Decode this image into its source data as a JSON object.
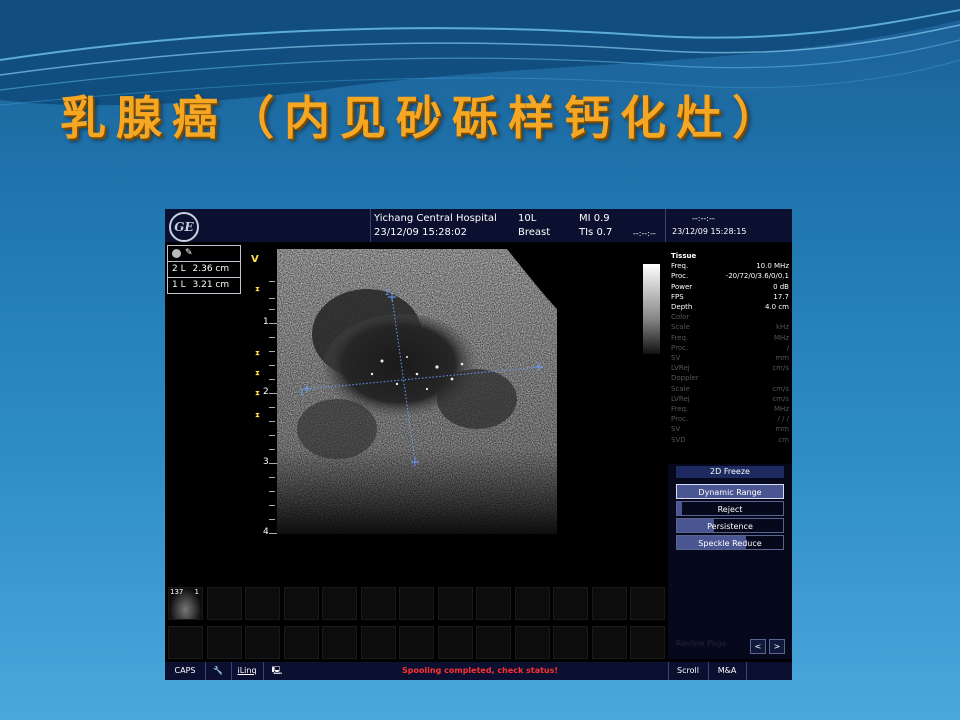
{
  "slide": {
    "title": "乳腺癌（内见砂砾样钙化灶）"
  },
  "device": {
    "logo": "GE",
    "hospital": "Yichang Central Hospital",
    "exam_datetime": "23/12/09 15:28:02",
    "probe": "10L",
    "preset": "Breast",
    "mi": "MI 0.9",
    "tis": "TIs 0.7",
    "time_placeholder": "--:--:--",
    "clock_top": "--:--:--",
    "clock_datetime": "23/12/09 15:28:15",
    "v_marker": "V"
  },
  "measurements": [
    {
      "index": "2",
      "type": "L",
      "value": "2.36 cm"
    },
    {
      "index": "1",
      "type": "L",
      "value": "3.21 cm"
    }
  ],
  "depth_labels": [
    "1",
    "2",
    "3",
    "4"
  ],
  "calipers": {
    "m1": "1",
    "m2": "2"
  },
  "parameters": {
    "tissue_header": "Tissue",
    "tissue": [
      {
        "label": "Freq.",
        "value": "10.0  MHz"
      },
      {
        "label": "Proc.",
        "value": "-20/72/0/3.6/0/0.1"
      },
      {
        "label": "Power",
        "value": "0  dB"
      },
      {
        "label": "FPS",
        "value": "17.7"
      },
      {
        "label": "Depth",
        "value": "4.0  cm"
      }
    ],
    "color_header": "Color",
    "color": [
      {
        "label": "Scale",
        "value": "kHz"
      },
      {
        "label": "Freq.",
        "value": "MHz"
      },
      {
        "label": "Proc.",
        "value": "/"
      },
      {
        "label": "SV",
        "value": "mm"
      },
      {
        "label": "LVRej",
        "value": "cm/s"
      }
    ],
    "doppler_header": "Doppler",
    "doppler": [
      {
        "label": "Scale",
        "value": "cm/s"
      },
      {
        "label": "LVRej",
        "value": "cm/s"
      },
      {
        "label": "Freq.",
        "value": "MHz"
      },
      {
        "label": "Proc.",
        "value": "/ / /"
      },
      {
        "label": "SV",
        "value": "mm"
      },
      {
        "label": "SVD",
        "value": "cm"
      }
    ]
  },
  "freeze_panel": {
    "title": "2D Freeze",
    "buttons": [
      {
        "label": "Dynamic Range",
        "level": 1.0
      },
      {
        "label": "Reject",
        "level": 0.05
      },
      {
        "label": "Persistence",
        "level": 0.35
      },
      {
        "label": "Speckle Reduce",
        "level": 0.65
      }
    ],
    "review_page": "Review Page",
    "prev": "<",
    "next": ">"
  },
  "thumbnail": {
    "label": "137",
    "index": "1"
  },
  "status_bar": {
    "caps": "CAPS",
    "iling": "iLinq",
    "message": "Spooling completed, check status!",
    "scroll": "Scroll",
    "ma": "M&A"
  },
  "colors": {
    "title_orange": "#f5a623",
    "caliper_blue": "#6a9cff",
    "focus_yellow": "#ffe14d",
    "status_red": "#ff3030"
  }
}
